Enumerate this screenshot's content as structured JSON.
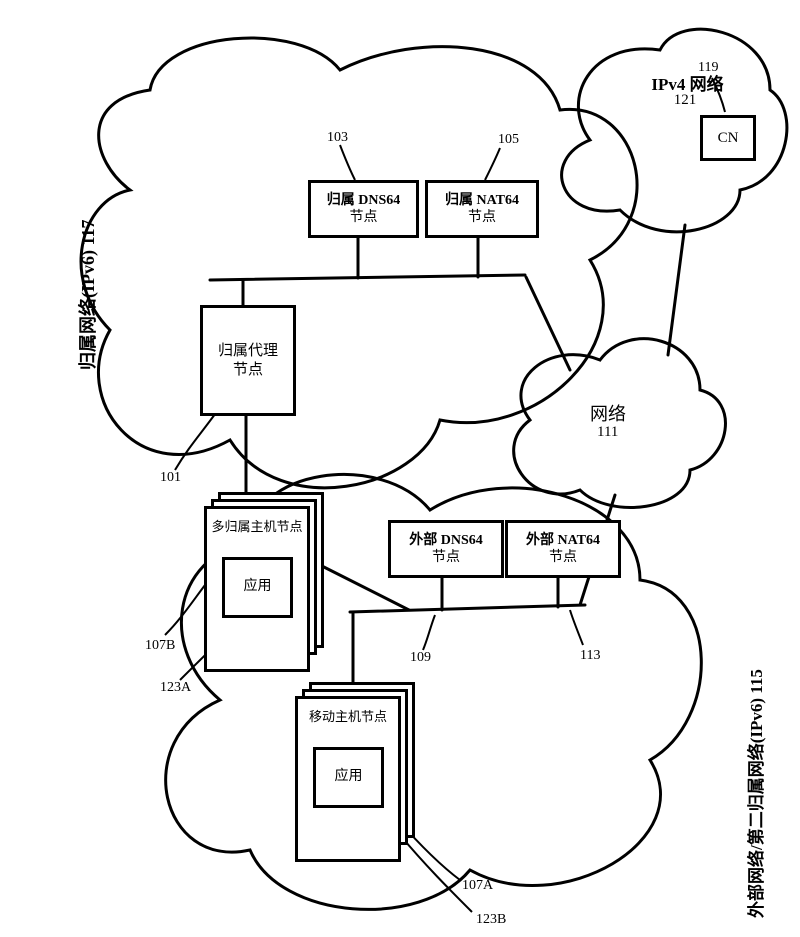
{
  "diagram": {
    "network_labels": {
      "home_network": "归属网络(IPv6) 117",
      "foreign_network": "外部网络/第二归属网络(IPv6) 115",
      "ipv4_label1": "IPv4 网络",
      "ipv4_label2": "121",
      "intermediate_network": "网络",
      "intermediate_network_num": "111"
    },
    "nodes": {
      "home_agent": {
        "l1": "归属代理",
        "l2": "节点",
        "ref": "101"
      },
      "home_dns64": {
        "l1": "归属 DNS64",
        "l2": "节点",
        "ref": "103"
      },
      "home_nat64": {
        "l1": "归属 NAT64",
        "l2": "节点",
        "ref": "105"
      },
      "foreign_dns64": {
        "l1": "外部 DNS64",
        "l2": "节点",
        "ref": "109"
      },
      "foreign_nat64": {
        "l1": "外部 NAT64",
        "l2": "节点",
        "ref": "113"
      },
      "cn": {
        "label": "CN",
        "ref": "119"
      },
      "multihomed_host": {
        "l1": "多归属主机节点",
        "app": "应用",
        "ref_node": "107B",
        "ref_app": "123A"
      },
      "mobile_host": {
        "l1": "移动主机节点",
        "app": "应用",
        "ref_node": "107A",
        "ref_app": "123B"
      }
    }
  }
}
